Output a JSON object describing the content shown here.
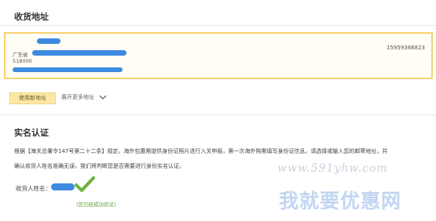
{
  "address_section": {
    "heading": "收货地址",
    "card": {
      "phone": "15959366823",
      "province": "广东省",
      "postcode": "518000"
    },
    "new_address_button": "使用新地址",
    "expand_more": "展开更多地址"
  },
  "realname_section": {
    "heading": "实名认证",
    "notice_line1": "根据【海关总署令147号第二十二条】规定，海外包惠需提供身份证照片进行入关申报，第一次海外购需填写身份证信息。请选择或输入您的邮寄地址，并",
    "notice_line2": "确认收货人姓名准确无误，我们将判断您是否需要进行身份实名认证。",
    "recipient_label": "收货人姓名：",
    "verified_text": "(您已经成功验证)"
  },
  "watermark": {
    "url": "www.591yhw.com",
    "site_name": "我就要优惠网"
  },
  "colors": {
    "card_border": "#f5d36e",
    "button_bg": "#fbe8a6",
    "redaction_blue": "#3d8be0",
    "verified_green": "#5ea33a"
  }
}
